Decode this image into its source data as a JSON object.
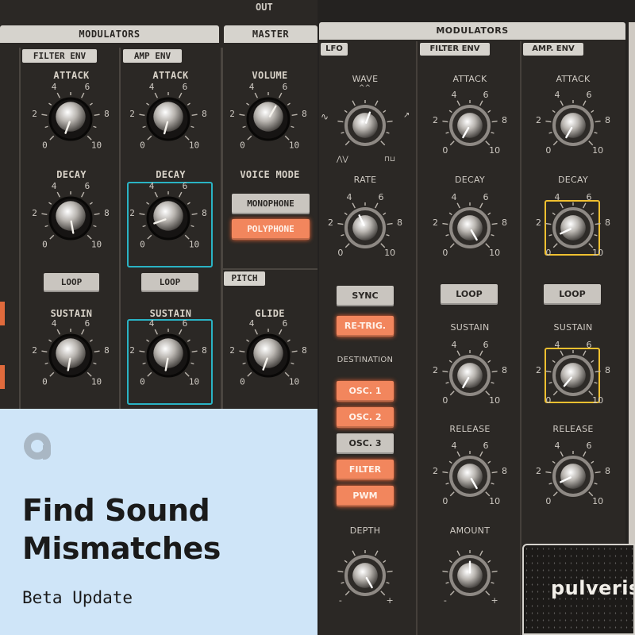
{
  "colors": {
    "accent_orange": "#f2865d",
    "highlight_teal": "#2ab3c4",
    "highlight_yellow": "#f0c030",
    "banner_bg": "#cfe5f8",
    "banner_text": "#1a1a1a"
  },
  "left_panel": {
    "out_label": "OUT",
    "modulators_title": "MODULATORS",
    "master_title": "MASTER",
    "filter_env_tab": "FILTER ENV",
    "amp_env_tab": "AMP ENV",
    "pitch_title": "PITCH",
    "attack": "ATTACK",
    "decay": "DECAY",
    "sustain": "SUSTAIN",
    "volume": "VOLUME",
    "voice_mode": "VOICE MODE",
    "glide": "GLIDE",
    "loop": "LOOP",
    "monophone": "MONOPHONE",
    "polyphone": "POLYPHONE",
    "scale": {
      "s0": "0",
      "s2": "2",
      "s4": "4",
      "s6": "6",
      "s8": "8",
      "s10": "10"
    }
  },
  "right_panel": {
    "modulators_title": "MODULATORS",
    "lfo_tab": "LFO",
    "filter_env_tab": "FILTER ENV",
    "amp_env_tab": "AMP. ENV",
    "wave": "WAVE",
    "rate": "RATE",
    "sync": "SYNC",
    "retrig": "RE-TRIG.",
    "destination": "DESTINATION",
    "destinations": [
      "OSC. 1",
      "OSC. 2",
      "OSC. 3",
      "FILTER",
      "PWM"
    ],
    "depth": "DEPTH",
    "attack": "ATTACK",
    "decay": "DECAY",
    "sustain": "SUSTAIN",
    "release": "RELEASE",
    "amount": "AMOUNT",
    "loop": "LOOP",
    "brand": "pulveris",
    "minus": "-",
    "plus": "+",
    "scale": {
      "s0": "0",
      "s2": "2",
      "s4": "4",
      "s6": "6",
      "s8": "8",
      "s10": "10"
    }
  },
  "banner": {
    "logo_letter": "a",
    "title_line1": "Find Sound",
    "title_line2": "Mismatches",
    "subtitle": "Beta Update"
  }
}
